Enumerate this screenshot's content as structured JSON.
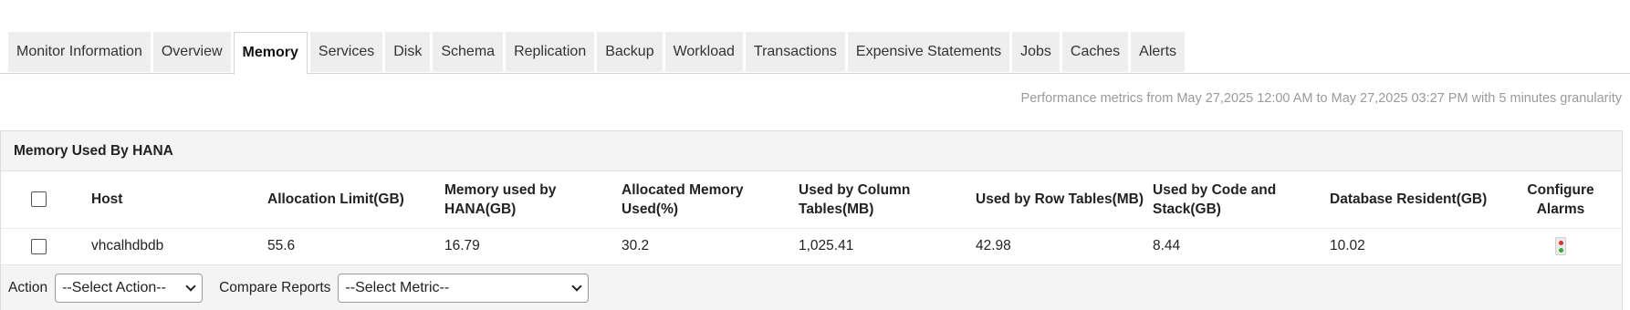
{
  "tabs": [
    {
      "label": "Monitor Information",
      "active": false
    },
    {
      "label": "Overview",
      "active": false
    },
    {
      "label": "Memory",
      "active": true
    },
    {
      "label": "Services",
      "active": false
    },
    {
      "label": "Disk",
      "active": false
    },
    {
      "label": "Schema",
      "active": false
    },
    {
      "label": "Replication",
      "active": false
    },
    {
      "label": "Backup",
      "active": false
    },
    {
      "label": "Workload",
      "active": false
    },
    {
      "label": "Transactions",
      "active": false
    },
    {
      "label": "Expensive Statements",
      "active": false
    },
    {
      "label": "Jobs",
      "active": false
    },
    {
      "label": "Caches",
      "active": false
    },
    {
      "label": "Alerts",
      "active": false
    }
  ],
  "perf_text": "Performance metrics from May 27,2025 12:00 AM to May 27,2025 03:27 PM with 5 minutes granularity",
  "panel": {
    "title": "Memory Used By HANA",
    "columns": {
      "host": "Host",
      "allocation_limit": "Allocation Limit(GB)",
      "memory_used": "Memory used by HANA(GB)",
      "allocated_pct": "Allocated Memory Used(%)",
      "col_tables": "Used by Column Tables(MB)",
      "row_tables": "Used by Row Tables(MB)",
      "code_stack": "Used by Code and Stack(GB)",
      "db_resident": "Database Resident(GB)",
      "configure_alarms": "Configure Alarms"
    },
    "rows": [
      {
        "host": "vhcalhdbdb",
        "allocation_limit": "55.6",
        "memory_used": "16.79",
        "allocated_pct": "30.2",
        "col_tables": "1,025.41",
        "row_tables": "42.98",
        "code_stack": "8.44",
        "db_resident": "10.02",
        "alarm_icon": "traffic-light-icon"
      }
    ]
  },
  "controls": {
    "action_label": "Action",
    "action_select": "--Select Action--",
    "compare_label": "Compare Reports",
    "compare_select": "--Select Metric--"
  },
  "colors": {
    "tab_bg": "#eeeeee",
    "panel_bg": "#f4f4f4",
    "muted_text": "#9a9a9a"
  }
}
